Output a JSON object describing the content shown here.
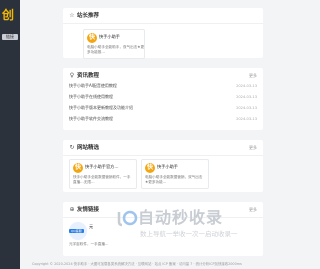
{
  "sidebar": {
    "logo_text": "创",
    "logo_tag": "链接"
  },
  "sections": {
    "recommend": {
      "title": "站长推荐",
      "icon": "star-icon",
      "item": {
        "avatar_char": "快",
        "name": "快手小助手",
        "desc": "电脑小助手全能助手，双气出击★更多功能推…"
      }
    },
    "news": {
      "title": "资讯教程",
      "icon": "lightbulb-icon",
      "more": "更多",
      "rows": [
        {
          "title": "快手小助手AI配音使用教程",
          "date": "2024-03-13"
        },
        {
          "title": "快手小助手在线使用教程",
          "date": "2024-03-13"
        },
        {
          "title": "快手小助手版本更新教程及功能介绍",
          "date": "2024-03-13"
        },
        {
          "title": "快手小助手软件交流教程",
          "date": "2024-03-13"
        }
      ]
    },
    "featured": {
      "title": "网站精选",
      "icon": "refresh-icon",
      "more": "更多",
      "items": [
        {
          "avatar_char": "快",
          "name": "快手小助手官方…",
          "desc": "快手小助手全能数据营销软件，一手直播…无限…"
        },
        {
          "avatar_char": "快",
          "name": "快手小助手",
          "desc": "电脑小助手全能数据营销，双气出击★更多功能…"
        }
      ]
    },
    "friends": {
      "title": "友情链接",
      "icon": "link-icon",
      "more": "更多",
      "item": {
        "label": "QQ客服",
        "name": "元",
        "desc": "元宇宙软件，一手直播…"
      }
    }
  },
  "watermark": {
    "brand": "自动秒收录",
    "slogan": "数上导航一举收一次一启动收录一"
  },
  "footer": {
    "text": "Copyright © 2020-2024 快手助手 · 大图可加载各类系统解决方法 · 互联网站 · 站点 ICP 备案 · 访问量 7 · 统计分析ICP加快接收2000ms"
  }
}
